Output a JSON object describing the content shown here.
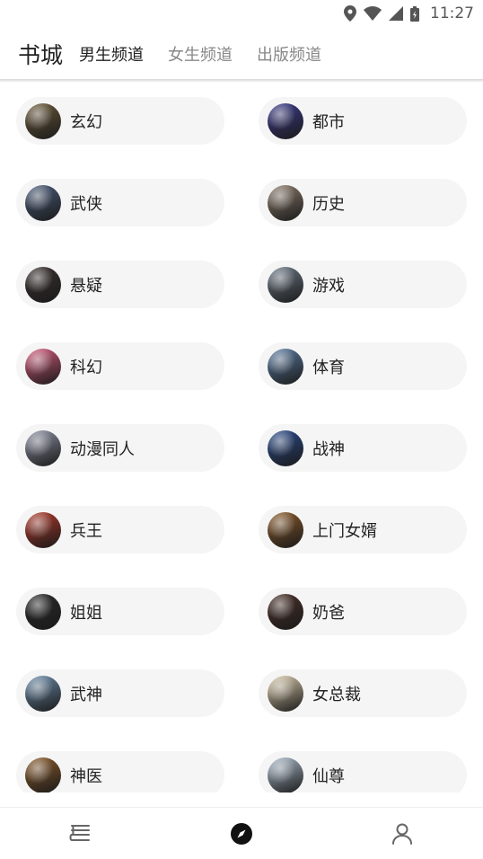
{
  "status": {
    "time": "11:27"
  },
  "header": {
    "title": "书城",
    "tabs": [
      {
        "label": "男生频道",
        "active": true
      },
      {
        "label": "女生频道",
        "active": false
      },
      {
        "label": "出版频道",
        "active": false
      }
    ]
  },
  "categories": [
    {
      "label": "玄幻",
      "cover_color": "#6b5a3a"
    },
    {
      "label": "都市",
      "cover_color": "#3b3a8a"
    },
    {
      "label": "武侠",
      "cover_color": "#4a5c7a"
    },
    {
      "label": "历史",
      "cover_color": "#8a7a6a"
    },
    {
      "label": "悬疑",
      "cover_color": "#3a3030"
    },
    {
      "label": "游戏",
      "cover_color": "#6a7684"
    },
    {
      "label": "科幻",
      "cover_color": "#d25a7a"
    },
    {
      "label": "体育",
      "cover_color": "#5a7aa0"
    },
    {
      "label": "动漫同人",
      "cover_color": "#8a8fa0"
    },
    {
      "label": "战神",
      "cover_color": "#2a4a8a"
    },
    {
      "label": "兵王",
      "cover_color": "#b03a2a"
    },
    {
      "label": "上门女婿",
      "cover_color": "#8a5a2a"
    },
    {
      "label": "姐姐",
      "cover_color": "#2a2a2a"
    },
    {
      "label": "奶爸",
      "cover_color": "#4a3028"
    },
    {
      "label": "武神",
      "cover_color": "#6a8aa8"
    },
    {
      "label": "女总裁",
      "cover_color": "#d8c8a8"
    },
    {
      "label": "神医",
      "cover_color": "#8a5a2a"
    },
    {
      "label": "仙尊",
      "cover_color": "#a8b8c8"
    }
  ],
  "bottom_nav": [
    {
      "icon": "bookshelf-icon"
    },
    {
      "icon": "compass-icon",
      "active": true
    },
    {
      "icon": "user-icon"
    }
  ]
}
